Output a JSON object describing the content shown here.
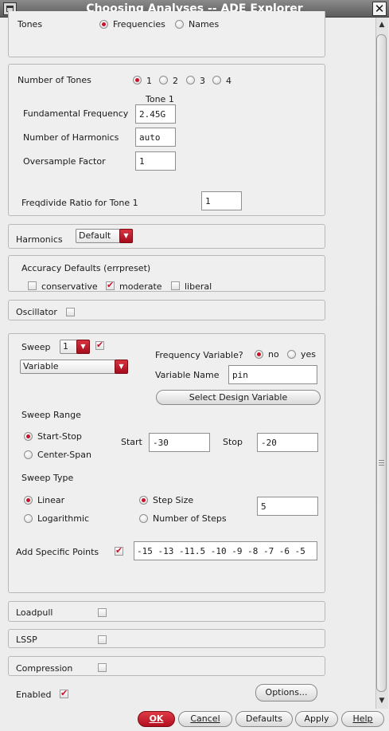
{
  "window": {
    "title": "Choosing Analyses -- ADE Explorer"
  },
  "tones": {
    "label": "Tones",
    "options": [
      "Frequencies",
      "Names"
    ],
    "selected": "Frequencies"
  },
  "num_tones": {
    "label": "Number of Tones",
    "options": [
      "1",
      "2",
      "3",
      "4"
    ],
    "selected": "1",
    "tone_header": "Tone 1",
    "fundamental_label": "Fundamental Frequency",
    "fundamental_value": "2.45G",
    "harmonics_label": "Number of Harmonics",
    "harmonics_value": "auto",
    "oversample_label": "Oversample Factor",
    "oversample_value": "1",
    "freqdivide_label": "Freqdivide Ratio for Tone 1",
    "freqdivide_value": "1"
  },
  "harmonics": {
    "label": "Harmonics",
    "value": "Default"
  },
  "accuracy": {
    "label": "Accuracy Defaults (errpreset)",
    "options": [
      "conservative",
      "moderate",
      "liberal"
    ],
    "checked": "moderate"
  },
  "oscillator": {
    "label": "Oscillator",
    "checked": false
  },
  "sweep": {
    "label": "Sweep",
    "count": "1",
    "enabled": true,
    "type_value": "Variable",
    "freq_var_label": "Frequency Variable?",
    "freq_var_options": [
      "no",
      "yes"
    ],
    "freq_var_selected": "no",
    "var_name_label": "Variable Name",
    "var_name_value": "pin",
    "select_var_button": "Select Design Variable",
    "range_label": "Sweep Range",
    "range_options": [
      "Start-Stop",
      "Center-Span"
    ],
    "range_selected": "Start-Stop",
    "start_label": "Start",
    "start_value": "-30",
    "stop_label": "Stop",
    "stop_value": "-20",
    "sweep_type_label": "Sweep Type",
    "sweep_type_options": [
      "Linear",
      "Logarithmic"
    ],
    "sweep_type_selected": "Linear",
    "step_options": [
      "Step Size",
      "Number of Steps"
    ],
    "step_selected": "Step Size",
    "step_value": "5",
    "specific_points_label": "Add Specific Points",
    "specific_points_checked": true,
    "specific_points_value": "-15 -13 -11.5 -10 -9 -8 -7 -6 -5"
  },
  "loadpull": {
    "label": "Loadpull",
    "checked": false
  },
  "lssp": {
    "label": "LSSP",
    "checked": false
  },
  "compression": {
    "label": "Compression",
    "checked": false
  },
  "enabled": {
    "label": "Enabled",
    "checked": true
  },
  "options_button": "Options...",
  "buttons": {
    "ok": "OK",
    "cancel": "Cancel",
    "defaults": "Defaults",
    "apply": "Apply",
    "help": "Help"
  },
  "colors": {
    "accent": "#c8122c",
    "title_bar": "#6e6e6e"
  }
}
